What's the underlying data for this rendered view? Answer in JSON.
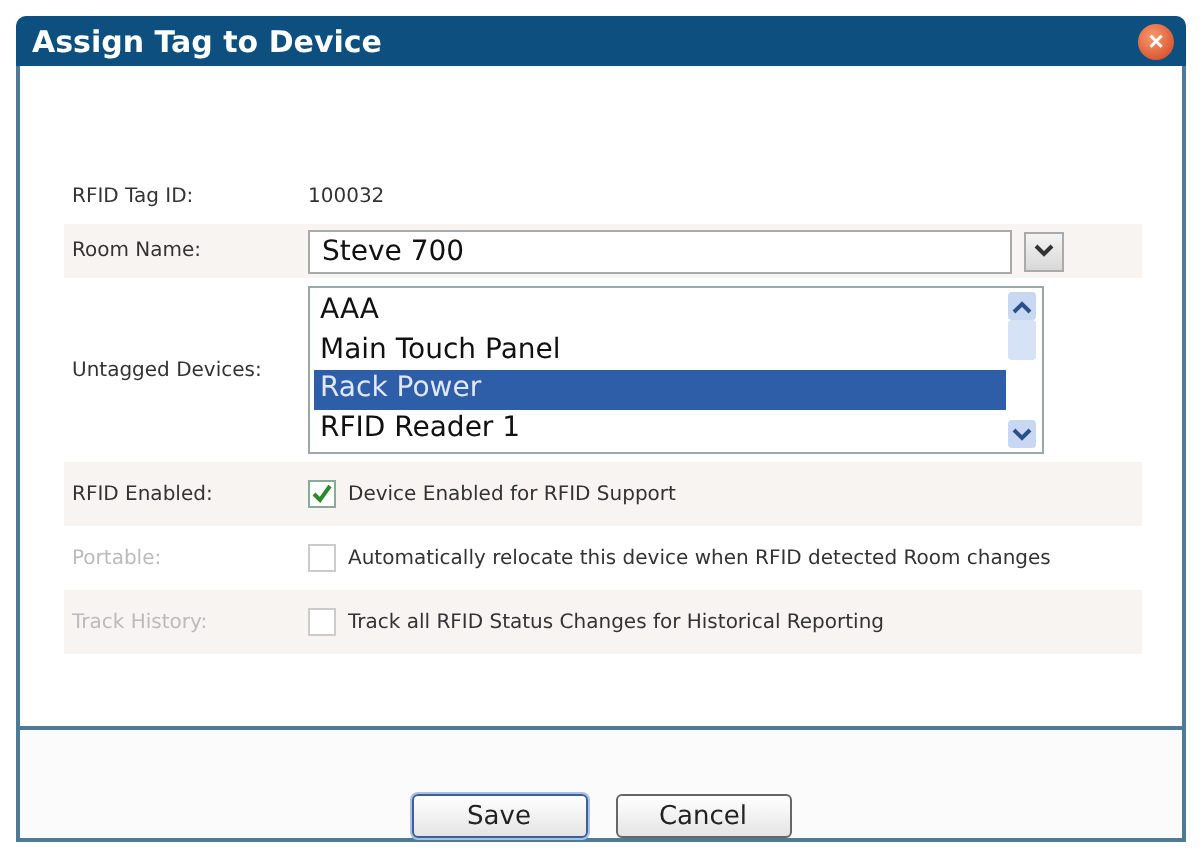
{
  "window": {
    "title": "Assign Tag to Device",
    "close": "×"
  },
  "tag": {
    "label": "RFID Tag ID:",
    "value": "100032"
  },
  "room": {
    "label": "Room Name:",
    "value": "Steve 700"
  },
  "devices": {
    "label": "Untagged Devices:",
    "items": [
      {
        "name": "AAA",
        "selected": false
      },
      {
        "name": "Main Touch Panel",
        "selected": false
      },
      {
        "name": "Rack Power",
        "selected": true
      },
      {
        "name": "RFID Reader 1",
        "selected": false
      }
    ]
  },
  "options": [
    {
      "label": "RFID Enabled:",
      "text": "Device Enabled for RFID Support",
      "checked": true,
      "disabled": false
    },
    {
      "label": "Portable:",
      "text": "Automatically relocate this device when RFID detected Room changes",
      "checked": false,
      "disabled": true
    },
    {
      "label": "Track History:",
      "text": "Track all RFID Status Changes for Historical Reporting",
      "checked": false,
      "disabled": true
    }
  ],
  "buttons": [
    {
      "label": "Save",
      "selected": true
    },
    {
      "label": "Cancel",
      "selected": false
    }
  ]
}
